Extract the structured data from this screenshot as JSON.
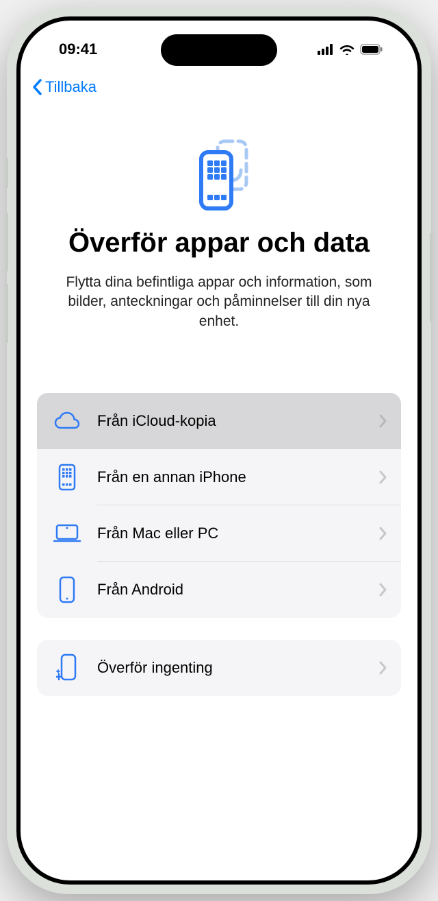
{
  "status": {
    "time": "09:41"
  },
  "nav": {
    "back_label": "Tillbaka"
  },
  "header": {
    "title": "Överför appar och data",
    "subtitle": "Flytta dina befintliga appar och information, som bilder, anteckningar och påminnelser till din nya enhet."
  },
  "options": {
    "group1": [
      {
        "label": "Från iCloud-kopia",
        "icon": "cloud",
        "highlighted": true
      },
      {
        "label": "Från en annan iPhone",
        "icon": "iphone-grid",
        "highlighted": false
      },
      {
        "label": "Från Mac eller PC",
        "icon": "laptop",
        "highlighted": false
      },
      {
        "label": "Från Android",
        "icon": "phone-outline",
        "highlighted": false
      }
    ],
    "group2": [
      {
        "label": "Överför ingenting",
        "icon": "phone-sparkle",
        "highlighted": false
      }
    ]
  },
  "colors": {
    "accent": "#007AFF",
    "light_accent": "#A9C9F5"
  }
}
